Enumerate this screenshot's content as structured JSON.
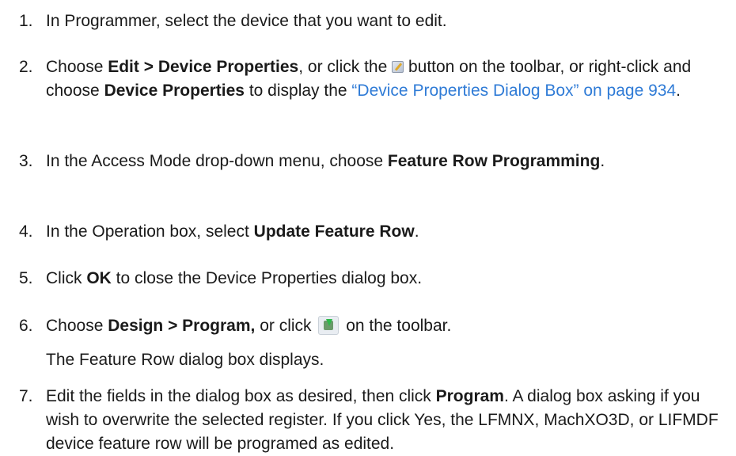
{
  "steps": [
    {
      "num": "1.",
      "text": "In Programmer, select the device that you want to edit."
    },
    {
      "num": "2.",
      "a": "Choose ",
      "b1": "Edit > Device Properties",
      "c": ", or click the ",
      "icon": "device-properties-icon",
      "d": " button on the toolbar, or right-click and choose ",
      "b2": "Device Properties",
      "e": " to display the ",
      "link": "“Device Properties Dialog Box” on page 934",
      "f": "."
    },
    {
      "num": "3.",
      "a": "In the Access Mode drop-down menu, choose ",
      "b1": "Feature Row Programming",
      "c": "."
    },
    {
      "num": "4.",
      "a": "In the Operation box, select ",
      "b1": "Update Feature Row",
      "c": "."
    },
    {
      "num": "5.",
      "a": "Click ",
      "b1": "OK",
      "c": " to close the Device Properties dialog box."
    },
    {
      "num": "6.",
      "a": "Choose ",
      "b1": "Design > Program,",
      "c": " or click ",
      "icon": "program-icon",
      "d": " on the toolbar.",
      "sub": "The Feature Row dialog box displays."
    },
    {
      "num": "7.",
      "a": "Edit the fields in the dialog box as desired, then click ",
      "b1": "Program",
      "c": ". A dialog box asking if you wish to overwrite the selected register. If you click Yes, the LFMNX, MachXO3D, or LIFMDF device feature row will be programed as edited."
    }
  ]
}
